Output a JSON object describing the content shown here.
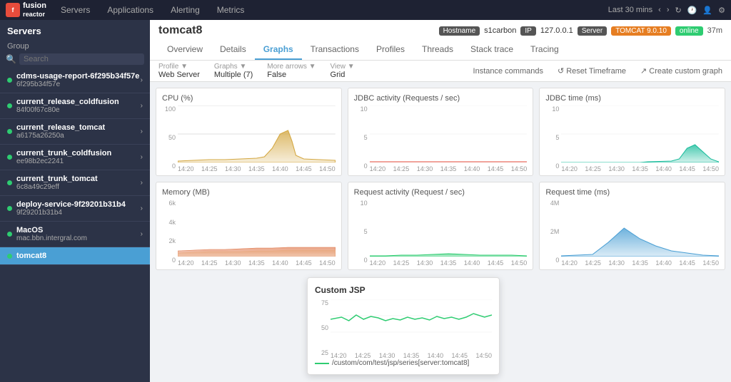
{
  "nav": {
    "logo": "reactor",
    "items": [
      "Servers",
      "Applications",
      "Alerting",
      "Metrics"
    ],
    "time_label": "Last 30 mins"
  },
  "sidebar": {
    "header": "Servers",
    "group_label": "Group",
    "search_placeholder": "Search",
    "servers": [
      {
        "name": "cdms-usage-report-6f295b34f57e",
        "id": "6f295b34f57e",
        "dot": "green",
        "active": false
      },
      {
        "name": "current_release_coldfusion",
        "id": "84f00f67c80e",
        "dot": "green",
        "active": false
      },
      {
        "name": "current_release_tomcat",
        "id": "a6175a26250a",
        "dot": "green",
        "active": false
      },
      {
        "name": "current_trunk_coldfusion",
        "id": "ee98b2ec2241",
        "dot": "green",
        "active": false
      },
      {
        "name": "current_trunk_tomcat",
        "id": "6c8a49c29eff",
        "dot": "green",
        "active": false
      },
      {
        "name": "deploy-service-9f29201b31b4",
        "id": "9f29201b31b4",
        "dot": "green",
        "active": false
      },
      {
        "name": "MacOS",
        "id": "mac.bbn.intergral.com",
        "dot": "green",
        "active": false
      },
      {
        "name": "tomcat8",
        "id": "",
        "dot": "green",
        "active": true
      }
    ]
  },
  "content": {
    "title": "tomcat8",
    "hostname_label": "Hostname",
    "hostname_val": "s1carbon",
    "ip_label": "IP",
    "ip_val": "127.0.0.1",
    "server_label": "Server",
    "server_val": "TOMCAT 9.0.10",
    "online_label": "online",
    "time_ago": "37m",
    "tabs": [
      "Overview",
      "Details",
      "Graphs",
      "Transactions",
      "Profiles",
      "Threads",
      "Stack trace",
      "Tracing"
    ],
    "active_tab": "Graphs",
    "sub_items": [
      {
        "label": "Profile ▼",
        "val": "Web Server"
      },
      {
        "label": "Graphs ▼",
        "val": "Multiple (7)"
      },
      {
        "label": "More arrows ▼",
        "val": "False"
      },
      {
        "label": "View ▼",
        "val": "Grid"
      }
    ],
    "commands_label": "Instance commands",
    "reset_label": "↺ Reset Timeframe",
    "create_label": "↗ Create custom graph"
  },
  "charts": [
    {
      "id": "cpu",
      "title": "CPU (%)",
      "y_max": "100",
      "y_mid": "50",
      "y_min": "0",
      "color": "#d4a843",
      "type": "area_cpu"
    },
    {
      "id": "jdbc_req",
      "title": "JDBC activity (Requests / sec)",
      "y_max": "10",
      "y_mid": "5",
      "y_min": "0",
      "color": "#e74c3c",
      "type": "flat"
    },
    {
      "id": "jdbc_time",
      "title": "JDBC time (ms)",
      "y_max": "10",
      "y_mid": "5",
      "y_min": "0",
      "color": "#1abc9c",
      "type": "area_jdbc"
    },
    {
      "id": "memory",
      "title": "Memory (MB)",
      "y_max": "6k",
      "y_mid": "4k",
      "y_sub": "2k",
      "y_min": "0",
      "color": "#e07b50",
      "type": "area_memory"
    },
    {
      "id": "req_act",
      "title": "Request activity (Request / sec)",
      "y_max": "10",
      "y_mid": "5",
      "y_min": "0",
      "color": "#2ecc71",
      "type": "area_req"
    },
    {
      "id": "req_time",
      "title": "Request time (ms)",
      "y_max": "4M",
      "y_mid": "2M",
      "y_min": "0",
      "color": "#4a9fd4",
      "type": "area_reqtime"
    }
  ],
  "time_labels": [
    "14:20",
    "14:25",
    "14:30",
    "14:35",
    "14:40",
    "14:45",
    "14:50"
  ],
  "popup": {
    "title": "Custom JSP",
    "y_max": "75",
    "y_mid": "50",
    "y_mid2": "25",
    "legend_text": "/custom/com/test/jsp/series[server:tomcat8]"
  }
}
